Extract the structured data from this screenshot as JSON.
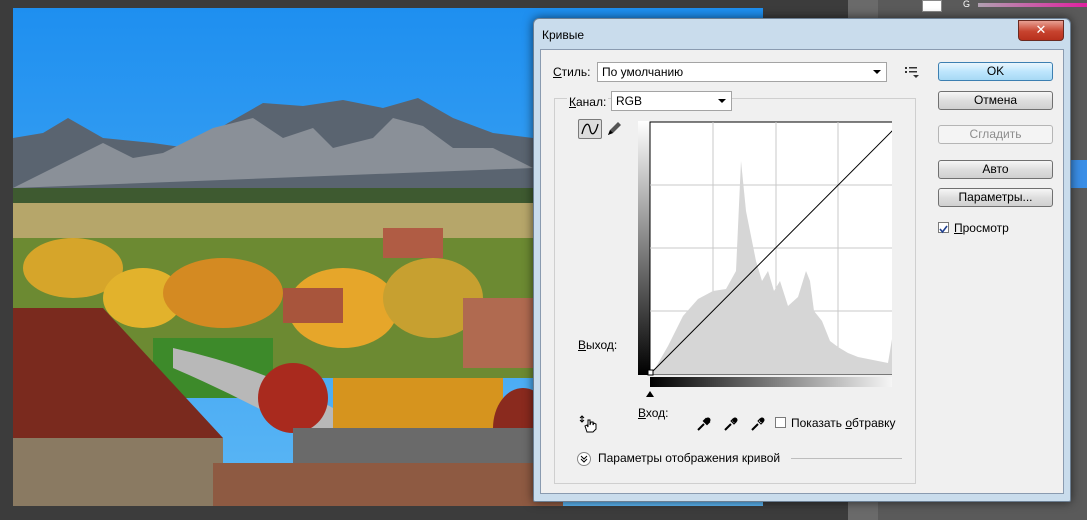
{
  "dialog": {
    "title": "Кривые",
    "close_glyph": "✕",
    "style_label_prefix": "С",
    "style_label_rest": "тиль:",
    "style_value": "По умолчанию",
    "channel_label_prefix": "К",
    "channel_label_rest": "анал:",
    "channel_value": "RGB",
    "output_label_prefix": "В",
    "output_label_rest": "ыход:",
    "input_label_prefix": "В",
    "input_label_rest": "ход:",
    "show_clipping_prefix": "Показать ",
    "show_clipping_u": "о",
    "show_clipping_rest": "бтравку",
    "display_options_label": "Параметры отображения кривой",
    "buttons": {
      "ok": "OK",
      "cancel": "Отмена",
      "smooth": "Сгладить",
      "auto": "Авто",
      "options": "Параметры..."
    },
    "preview_prefix": "П",
    "preview_rest": "росмотр",
    "preview_checked": true,
    "show_clipping_checked": false
  },
  "panel": {
    "g_label": "G"
  },
  "icons": {
    "preset_menu": "preset-menu-icon",
    "curve_tool": "curve-point-icon",
    "pencil_tool": "pencil-icon",
    "targeted_adjust": "hand-adjust-icon",
    "black_eyedropper": "eyedropper-black-icon",
    "gray_eyedropper": "eyedropper-gray-icon",
    "white_eyedropper": "eyedropper-white-icon",
    "expand": "chevron-down-icon"
  }
}
